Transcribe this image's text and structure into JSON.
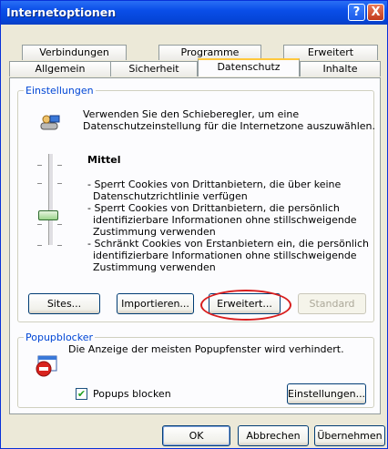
{
  "window": {
    "title": "Internetoptionen",
    "help_glyph": "?",
    "close_glyph": "X"
  },
  "tabs": {
    "row1": [
      "Verbindungen",
      "Programme",
      "Erweitert"
    ],
    "row2": [
      "Allgemein",
      "Sicherheit",
      "Datenschutz",
      "Inhalte"
    ],
    "active": "Datenschutz"
  },
  "settings": {
    "legend": "Einstellungen",
    "intro_line1": "Verwenden Sie den Schieberegler, um eine",
    "intro_line2": "Datenschutzeinstellung für die Internetzone auszuwählen.",
    "level_title": "Mittel",
    "desc": [
      "- Sperrt Cookies von Drittanbietern, die über keine",
      "Datenschutzrichtlinie verfügen",
      "- Sperrt Cookies von Drittanbietern, die persönlich",
      "identifizierbare Informationen ohne stillschweigende",
      "Zustimmung verwenden",
      "- Schränkt Cookies von Erstanbietern ein, die persönlich",
      "identifizierbare Informationen ohne stillschweigende",
      "Zustimmung verwenden"
    ],
    "buttons": {
      "sites": "Sites...",
      "import": "Importieren...",
      "advanced": "Erweitert...",
      "default": "Standard"
    }
  },
  "popup": {
    "legend": "Popupblocker",
    "text": "Die Anzeige der meisten Popupfenster wird verhindert.",
    "checkbox_label": "Popups blocken",
    "checkbox_mark": "✔",
    "checked": true,
    "settings_button": "Einstellungen..."
  },
  "footer": {
    "ok": "OK",
    "cancel": "Abbrechen",
    "apply": "Übernehmen"
  }
}
